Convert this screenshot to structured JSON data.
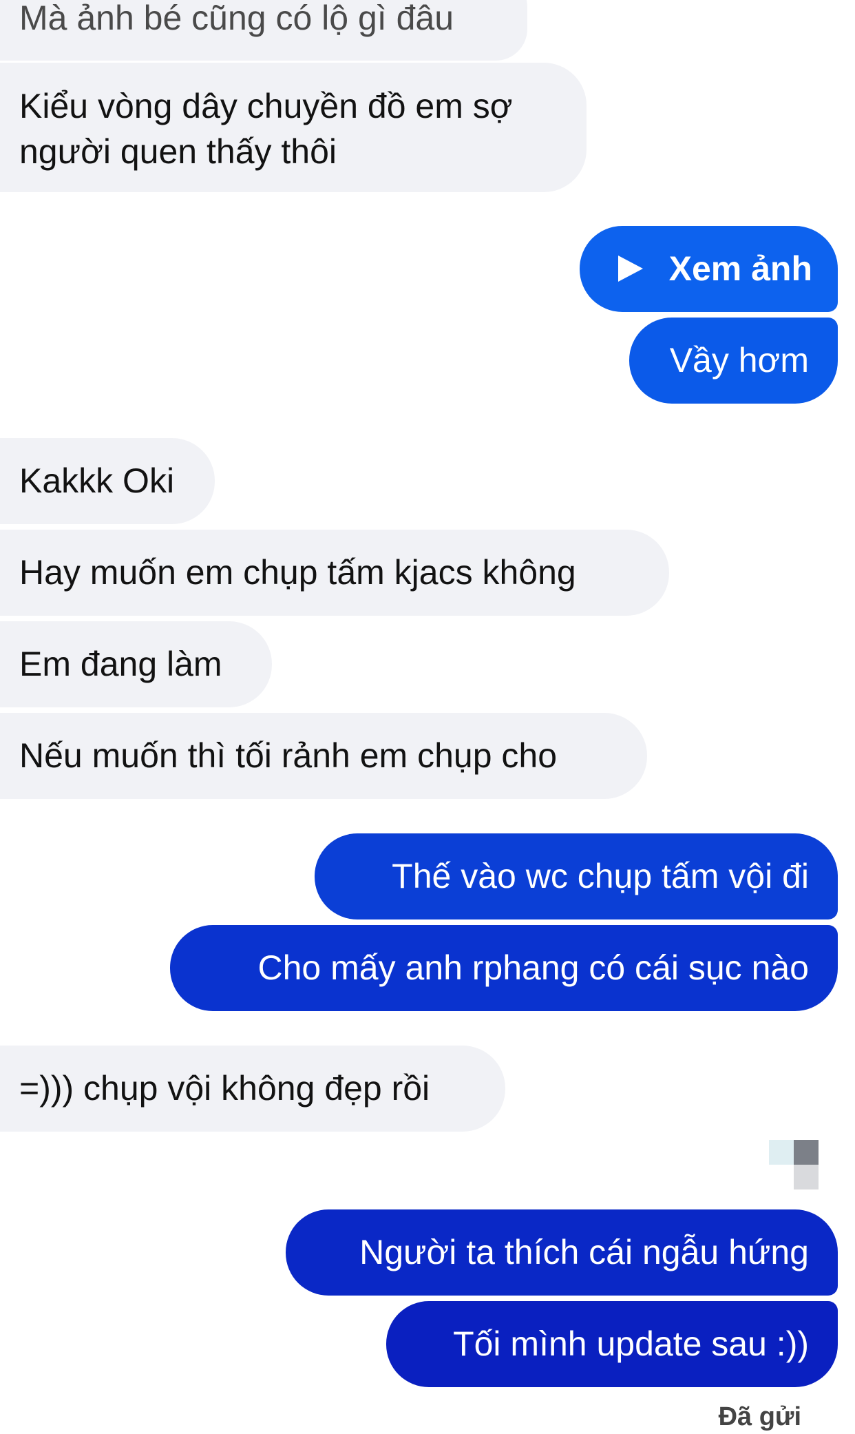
{
  "conversation": {
    "messages": [
      {
        "id": "m1",
        "direction": "incoming",
        "text": "Mà ảnh bé cũng có lộ gì đâu"
      },
      {
        "id": "m2",
        "direction": "incoming",
        "text": "Kiểu vòng dây chuyền đồ em sợ người quen thấy thôi"
      },
      {
        "id": "m3",
        "direction": "outgoing",
        "type": "media",
        "text": "Xem ảnh",
        "icon": "play-icon"
      },
      {
        "id": "m4",
        "direction": "outgoing",
        "text": "Vầy hơm"
      },
      {
        "id": "m5",
        "direction": "incoming",
        "text": "Kakkk Oki"
      },
      {
        "id": "m6",
        "direction": "incoming",
        "text": "Hay muốn em chụp tấm kjacs không"
      },
      {
        "id": "m7",
        "direction": "incoming",
        "text": "Em đang làm"
      },
      {
        "id": "m8",
        "direction": "incoming",
        "text": "Nếu muốn thì tối rảnh em chụp cho"
      },
      {
        "id": "m9",
        "direction": "outgoing",
        "text": "Thế vào wc chụp tấm vội đi"
      },
      {
        "id": "m10",
        "direction": "outgoing",
        "text": "Cho mấy anh rphang có cái sục nào"
      },
      {
        "id": "m11",
        "direction": "incoming",
        "text": "=))) chụp vội không đẹp rồi"
      },
      {
        "id": "m12",
        "direction": "outgoing",
        "text": "Người ta thích cái ngẫu hứng"
      },
      {
        "id": "m13",
        "direction": "outgoing",
        "text": "Tối mình update sau :))"
      }
    ],
    "status": "Đã gửi"
  },
  "colors": {
    "incoming_bg": "#f1f2f6",
    "outgoing_gradient": [
      "#0d63ef",
      "#0b3fd6",
      "#0a22c2"
    ],
    "incoming_text": "#121212",
    "outgoing_text": "#ffffff"
  }
}
